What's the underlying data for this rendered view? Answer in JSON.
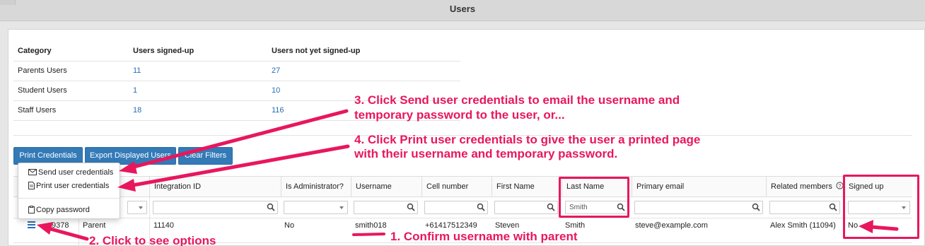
{
  "header": {
    "title": "Users"
  },
  "summary": {
    "headers": [
      "Category",
      "Users signed-up",
      "Users not yet signed-up"
    ],
    "rows": [
      {
        "category": "Parents Users",
        "signed_up": "11",
        "not_signed_up": "27"
      },
      {
        "category": "Student Users",
        "signed_up": "1",
        "not_signed_up": "10"
      },
      {
        "category": "Staff Users",
        "signed_up": "18",
        "not_signed_up": "116"
      }
    ]
  },
  "toolbar": {
    "print_credentials": "Print Credentials",
    "export_displayed": "Export Displayed Users",
    "clear_filters": "Clear Filters"
  },
  "menu": {
    "send": "Send user credentials",
    "print": "Print user credentials",
    "copy": "Copy password"
  },
  "grid": {
    "columns": {
      "integration_id": "Integration ID",
      "is_admin": "Is Administrator?",
      "username": "Username",
      "cell": "Cell number",
      "first_name": "First Name",
      "last_name": "Last Name",
      "email": "Primary email",
      "related": "Related members",
      "signed_up": "Signed up"
    },
    "filters": {
      "last_name": "Smith"
    },
    "row": {
      "id": "9378",
      "type": "Parent",
      "integration_id": "11140",
      "is_admin": "No",
      "username": "smith018",
      "cell": "+61417512349",
      "first_name": "Steven",
      "last_name": "Smith",
      "email": "steve@example.com",
      "related": "Alex Smith (11094)",
      "signed_up": "No"
    }
  },
  "annotations": {
    "step1": "1. Confirm username with parent",
    "step2": "2. Click to see options",
    "step3_line1": "3. Click Send user credentials to email the username and",
    "step3_line2": "temporary password to the user, or...",
    "step4_line1": "4. Click Print user credentials to give the user a printed page",
    "step4_line2": "with their username and temporary password.",
    "color": "#e8175d"
  },
  "icons": {
    "envelope": "envelope-icon",
    "document": "document-icon",
    "clipboard": "clipboard-icon",
    "search": "search-icon",
    "menu": "hamburger-menu-icon",
    "help": "question-circle-icon",
    "caret": "caret-down-icon"
  }
}
